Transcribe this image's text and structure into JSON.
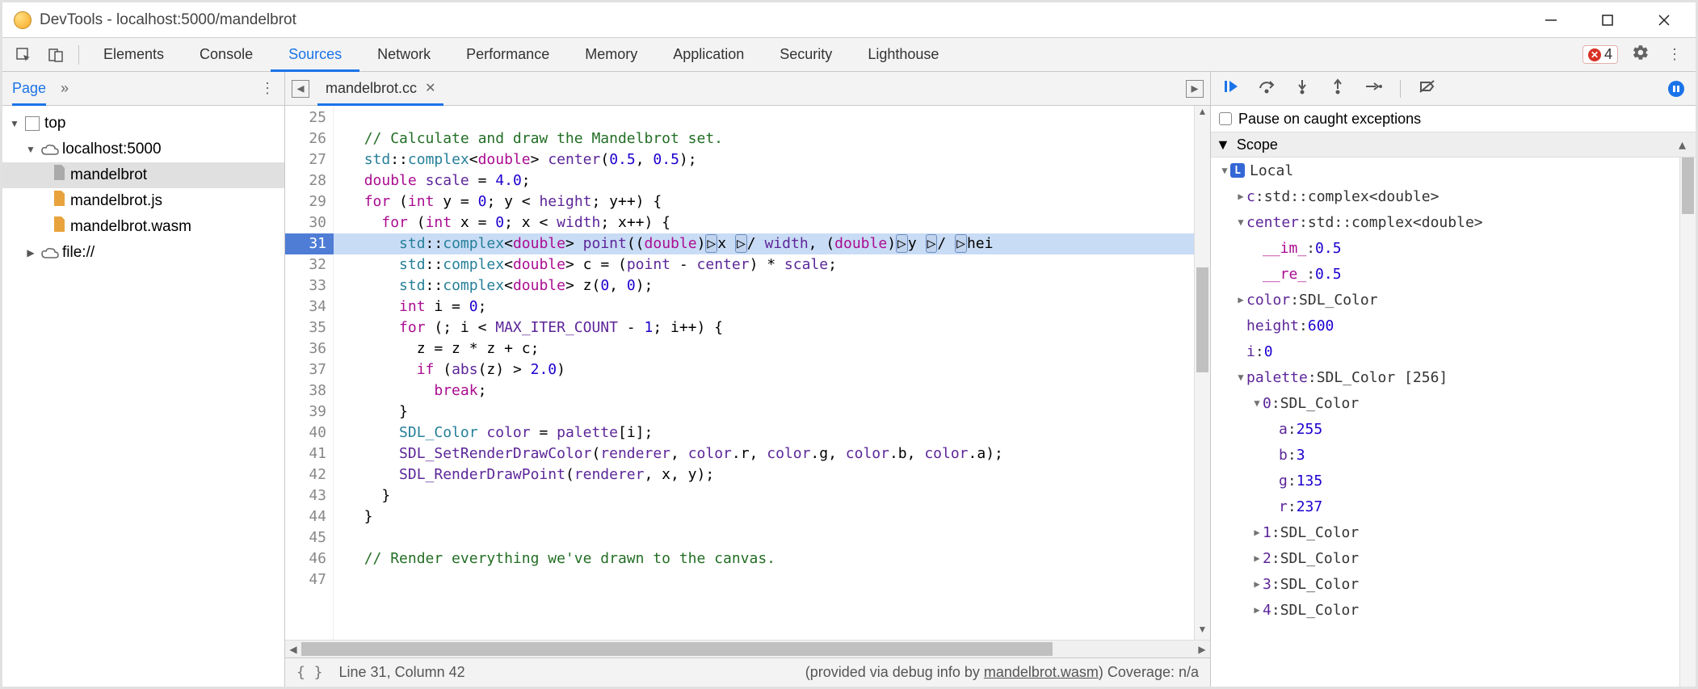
{
  "window": {
    "title": "DevTools - localhost:5000/mandelbrot"
  },
  "tabs": [
    "Elements",
    "Console",
    "Sources",
    "Network",
    "Performance",
    "Memory",
    "Application",
    "Security",
    "Lighthouse"
  ],
  "tabs_active_index": 2,
  "error_count": "4",
  "left": {
    "active_tab": "Page",
    "tree": {
      "root": "top",
      "host": "localhost:5000",
      "files": [
        "mandelbrot",
        "mandelbrot.js",
        "mandelbrot.wasm"
      ],
      "selected_index": 0,
      "extra": "file://"
    }
  },
  "editor": {
    "file": "mandelbrot.cc",
    "breakpoint_line": 31,
    "first_line": 25,
    "lines": [
      "",
      "  // Calculate and draw the Mandelbrot set.",
      "  std::complex<double> center(0.5, 0.5);",
      "  double scale = 4.0;",
      "  for (int y = 0; y < height; y++) {",
      "    for (int x = 0; x < width; x++) {",
      "      std::complex<double> point((double)x / width, (double)y / hei",
      "      std::complex<double> c = (point - center) * scale;",
      "      std::complex<double> z(0, 0);",
      "      int i = 0;",
      "      for (; i < MAX_ITER_COUNT - 1; i++) {",
      "        z = z * z + c;",
      "        if (abs(z) > 2.0)",
      "          break;",
      "      }",
      "      SDL_Color color = palette[i];",
      "      SDL_SetRenderDrawColor(renderer, color.r, color.g, color.b, color.a);",
      "      SDL_RenderDrawPoint(renderer, x, y);",
      "    }",
      "  }",
      "",
      "  // Render everything we've drawn to the canvas.",
      ""
    ],
    "status": {
      "pos": "Line 31, Column 42",
      "info": "(provided via debug info by ",
      "link": "mandelbrot.wasm",
      "info2": ") Coverage: n/a"
    }
  },
  "debugger": {
    "pause_on_caught": "Pause on caught exceptions",
    "scope_label": "Scope",
    "local_label": "Local",
    "vars": {
      "c": "std::complex<double>",
      "center": "std::complex<double>",
      "center_im": "0.5",
      "center_re": "0.5",
      "color": "SDL_Color",
      "height": "600",
      "i": "0",
      "palette": "SDL_Color [256]",
      "p0": "SDL_Color",
      "p0a": "255",
      "p0b": "3",
      "p0g": "135",
      "p0r": "237",
      "p1": "SDL_Color",
      "p2": "SDL_Color",
      "p3": "SDL_Color",
      "p4": "SDL_Color"
    }
  }
}
